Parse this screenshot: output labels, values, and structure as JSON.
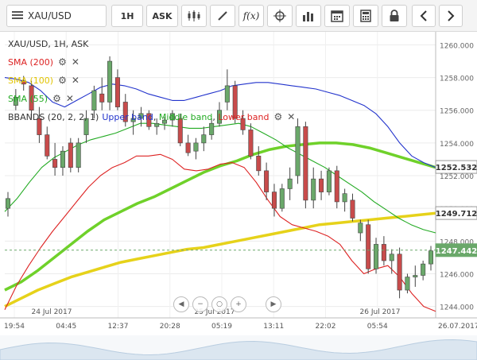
{
  "toolbar": {
    "symbol": "XAU/USD",
    "timeframe": "1H",
    "price_type": "ASK",
    "icons": [
      "list-icon",
      "candles-icon",
      "draw-line-icon",
      "indicator-fx-icon",
      "crosshair-icon",
      "bar-chart-icon",
      "calendar-icon",
      "calculator-icon",
      "lock-icon",
      "prev-icon",
      "next-icon"
    ],
    "fx_label": "f(x)"
  },
  "legend": {
    "title": "XAU/USD, 1H, ASK",
    "sma200": "SMA (200)",
    "sma100": "SMA (100)",
    "sma55": "SMA (55)",
    "bbands": "BBANDS (20, 2, 2, 1)",
    "upper": "Upper band",
    "middle": "Middle band",
    "lower": "Lower band"
  },
  "colors": {
    "upper": "#2233cc",
    "middle": "#22aa22",
    "lower": "#dd2222",
    "sma200": "#dd2222",
    "sma100": "#e2c400",
    "sma55": "#22aa22",
    "sma100_line": "#e6d21a",
    "sma55_line": "#6fd12a",
    "bull": "#6aa86a",
    "bear": "#c84b4b"
  },
  "axis": {
    "y_ticks": [
      "1260.000",
      "1258.000",
      "1256.000",
      "1254.000",
      "1252.000",
      "1250.000",
      "1248.000",
      "1246.000",
      "1244.000"
    ],
    "x_ticks": [
      "19:54",
      "04:45",
      "12:37",
      "20:28",
      "05:19",
      "13:11",
      "22:02",
      "05:54",
      "26.07.2017"
    ],
    "date_labels": [
      "24 Jul 2017",
      "25 Jul 2017",
      "26 Jul 2017"
    ]
  },
  "badges": {
    "sma55_value": "1252.532",
    "sma100_value": "1249.712",
    "price_value": "1247.442"
  },
  "chart_data": {
    "type": "line",
    "title": "XAU/USD, 1H, ASK",
    "ylim": [
      1243.3,
      1260.8
    ],
    "x_ticks": [
      "19:54",
      "04:45",
      "12:37",
      "20:28",
      "05:19",
      "13:11",
      "22:02",
      "05:54",
      "26.07.2017"
    ],
    "candles": [
      [
        1250.0,
        1251.0,
        1249.5,
        1250.6
      ],
      [
        1256.3,
        1257.3,
        1256.0,
        1256.8
      ],
      [
        1257.8,
        1258.1,
        1257.2,
        1257.6
      ],
      [
        1257.5,
        1257.8,
        1255.5,
        1256.0
      ],
      [
        1255.5,
        1256.2,
        1254.0,
        1254.5
      ],
      [
        1254.5,
        1255.0,
        1253.0,
        1253.2
      ],
      [
        1253.0,
        1254.0,
        1252.0,
        1252.5
      ],
      [
        1252.5,
        1253.8,
        1252.0,
        1253.5
      ],
      [
        1254.0,
        1254.3,
        1252.2,
        1252.5
      ],
      [
        1252.5,
        1254.3,
        1252.2,
        1254.0
      ],
      [
        1254.5,
        1256.0,
        1254.0,
        1255.5
      ],
      [
        1256.0,
        1257.5,
        1255.5,
        1257.2
      ],
      [
        1257.0,
        1258.0,
        1256.0,
        1256.5
      ],
      [
        1256.5,
        1259.3,
        1256.0,
        1259.0
      ],
      [
        1258.0,
        1258.5,
        1256.0,
        1256.2
      ],
      [
        1256.5,
        1257.0,
        1255.0,
        1255.3
      ],
      [
        1255.3,
        1256.0,
        1254.5,
        1255.5
      ],
      [
        1255.5,
        1256.2,
        1255.0,
        1255.8
      ],
      [
        1255.8,
        1256.0,
        1254.8,
        1255.0
      ],
      [
        1255.0,
        1255.5,
        1254.5,
        1255.2
      ],
      [
        1255.2,
        1255.6,
        1254.8,
        1255.4
      ],
      [
        1255.4,
        1256.0,
        1255.0,
        1255.8
      ],
      [
        1255.5,
        1255.8,
        1253.8,
        1254.0
      ],
      [
        1254.0,
        1254.5,
        1253.2,
        1253.4
      ],
      [
        1253.5,
        1254.3,
        1253.0,
        1254.0
      ],
      [
        1254.0,
        1255.0,
        1253.5,
        1254.5
      ],
      [
        1254.5,
        1255.5,
        1254.2,
        1255.2
      ],
      [
        1255.2,
        1256.5,
        1255.0,
        1256.0
      ],
      [
        1256.5,
        1258.5,
        1256.0,
        1257.5
      ],
      [
        1257.5,
        1257.8,
        1255.2,
        1255.5
      ],
      [
        1255.5,
        1256.0,
        1254.5,
        1254.8
      ],
      [
        1254.8,
        1255.2,
        1253.0,
        1253.2
      ],
      [
        1253.2,
        1253.8,
        1252.0,
        1252.3
      ],
      [
        1252.3,
        1252.8,
        1250.5,
        1251.0
      ],
      [
        1251.0,
        1251.5,
        1249.5,
        1250.0
      ],
      [
        1250.0,
        1251.5,
        1249.8,
        1251.2
      ],
      [
        1251.2,
        1252.5,
        1250.5,
        1251.8
      ],
      [
        1252.0,
        1255.5,
        1251.5,
        1255.0
      ],
      [
        1255.0,
        1255.3,
        1250.0,
        1250.5
      ],
      [
        1250.5,
        1252.5,
        1250.0,
        1251.8
      ],
      [
        1251.8,
        1252.3,
        1250.5,
        1251.0
      ],
      [
        1251.0,
        1252.5,
        1250.8,
        1252.3
      ],
      [
        1252.3,
        1252.6,
        1250.0,
        1250.4
      ],
      [
        1250.4,
        1251.2,
        1249.8,
        1250.9
      ],
      [
        1250.5,
        1250.9,
        1249.2,
        1249.4
      ],
      [
        1248.5,
        1249.3,
        1248.0,
        1249.1
      ],
      [
        1249.0,
        1249.3,
        1246.0,
        1246.3
      ],
      [
        1246.3,
        1248.2,
        1246.0,
        1247.8
      ],
      [
        1247.8,
        1248.3,
        1246.5,
        1246.8
      ],
      [
        1246.8,
        1247.5,
        1246.0,
        1247.2
      ],
      [
        1247.2,
        1247.6,
        1244.5,
        1245.0
      ],
      [
        1245.0,
        1246.0,
        1244.8,
        1245.8
      ],
      [
        1245.8,
        1246.5,
        1245.2,
        1245.9
      ],
      [
        1245.9,
        1246.8,
        1245.6,
        1246.6
      ],
      [
        1246.6,
        1247.7,
        1246.2,
        1247.4
      ]
    ],
    "series": [
      {
        "name": "Upper band",
        "values": [
          1258.0,
          1257.9,
          1257.7,
          1257.2,
          1256.5,
          1256.2,
          1256.6,
          1257.0,
          1257.4,
          1257.6,
          1257.5,
          1257.3,
          1257.0,
          1256.8,
          1256.6,
          1256.6,
          1256.8,
          1257.0,
          1257.2,
          1257.5,
          1257.6,
          1257.7,
          1257.7,
          1257.6,
          1257.5,
          1257.4,
          1257.3,
          1257.1,
          1256.9,
          1256.6,
          1256.3,
          1255.8,
          1255.0,
          1254.0,
          1253.2,
          1252.8,
          1252.5
        ]
      },
      {
        "name": "Middle band",
        "values": [
          1249.8,
          1250.6,
          1251.6,
          1252.5,
          1253.1,
          1253.5,
          1253.9,
          1254.2,
          1254.4,
          1254.6,
          1254.9,
          1255.2,
          1255.2,
          1255.1,
          1255.0,
          1254.9,
          1254.9,
          1255.0,
          1255.1,
          1255.2,
          1255.0,
          1254.6,
          1254.2,
          1253.7,
          1253.3,
          1252.9,
          1252.5,
          1252.0,
          1251.5,
          1251.0,
          1250.4,
          1249.9,
          1249.4,
          1249.0,
          1248.7,
          1248.5
        ]
      },
      {
        "name": "Lower band",
        "values": [
          1243.8,
          1245.3,
          1246.5,
          1247.6,
          1248.6,
          1249.5,
          1250.4,
          1251.3,
          1252.0,
          1252.5,
          1252.8,
          1253.2,
          1253.2,
          1253.3,
          1253.0,
          1252.4,
          1252.3,
          1252.4,
          1252.7,
          1252.8,
          1252.5,
          1251.6,
          1250.5,
          1249.5,
          1249.0,
          1248.8,
          1248.6,
          1248.3,
          1247.8,
          1246.8,
          1246.0,
          1246.3,
          1246.5,
          1245.8,
          1244.8,
          1244.0,
          1243.7
        ]
      },
      {
        "name": "SMA (100)",
        "values": [
          1244.0,
          1244.5,
          1245.0,
          1245.4,
          1245.8,
          1246.1,
          1246.4,
          1246.7,
          1246.9,
          1247.1,
          1247.3,
          1247.5,
          1247.6,
          1247.8,
          1248.0,
          1248.2,
          1248.4,
          1248.6,
          1248.8,
          1249.0,
          1249.1,
          1249.2,
          1249.3,
          1249.4,
          1249.5,
          1249.6,
          1249.7
        ]
      },
      {
        "name": "SMA (55)",
        "values": [
          1245.0,
          1245.5,
          1246.2,
          1247.0,
          1247.8,
          1248.6,
          1249.3,
          1249.8,
          1250.3,
          1250.7,
          1251.2,
          1251.7,
          1252.2,
          1252.6,
          1252.9,
          1253.3,
          1253.6,
          1253.8,
          1253.9,
          1254.0,
          1254.0,
          1253.9,
          1253.7,
          1253.4,
          1253.1,
          1252.8,
          1252.5
        ]
      }
    ]
  }
}
